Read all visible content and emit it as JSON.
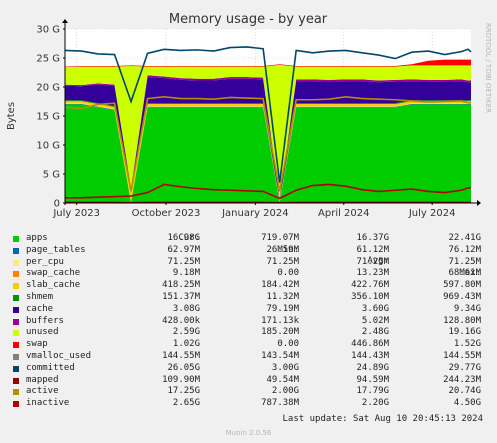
{
  "chart_data": {
    "type": "area",
    "title": "Memory usage - by year",
    "ylabel": "Bytes",
    "xlabel": "",
    "ylim": [
      0,
      30
    ],
    "yticks": [
      0,
      5,
      10,
      15,
      20,
      25,
      30
    ],
    "ytick_labels": [
      "0",
      "5 G",
      "10 G",
      "15 G",
      "20 G",
      "25 G",
      "30 G"
    ],
    "x_range": [
      "2023-06-19",
      "2024-08-10"
    ],
    "xticks": [
      {
        "date": "2023-07-01",
        "label": "July 2023"
      },
      {
        "date": "2023-10-01",
        "label": "October 2023"
      },
      {
        "date": "2024-01-01",
        "label": "January 2024"
      },
      {
        "date": "2024-04-01",
        "label": "April 2024"
      },
      {
        "date": "2024-07-01",
        "label": "July 2024"
      }
    ],
    "grid": true,
    "stacked_series": [
      {
        "name": "apps",
        "color": "#00cc00",
        "values": [
          17,
          17,
          16.5,
          16,
          0.1,
          16.5,
          16.5,
          16.5,
          16.5,
          16.5,
          16.5,
          16.5,
          16.5,
          0.1,
          16.5,
          16.5,
          16.5,
          16.5,
          16.5,
          16.5,
          16.5,
          17,
          17,
          17,
          17,
          17,
          17
        ]
      },
      {
        "name": "page_tables",
        "color": "#0066b3",
        "values": [
          0.1,
          0.1,
          0.1,
          0.1,
          0.05,
          0.1,
          0.1,
          0.1,
          0.1,
          0.1,
          0.1,
          0.1,
          0.1,
          0.05,
          0.1,
          0.1,
          0.1,
          0.1,
          0.1,
          0.1,
          0.1,
          0.1,
          0.1,
          0.1,
          0.1,
          0.1,
          0.1
        ]
      },
      {
        "name": "per_cpu",
        "color": "#ffe680",
        "values": [
          0.07,
          0.07,
          0.07,
          0.07,
          0.07,
          0.07,
          0.07,
          0.07,
          0.07,
          0.07,
          0.07,
          0.07,
          0.07,
          0.07,
          0.07,
          0.07,
          0.07,
          0.07,
          0.07,
          0.07,
          0.07,
          0.07,
          0.07,
          0.07,
          0.07,
          0.07,
          0.07
        ]
      },
      {
        "name": "swap_cache",
        "color": "#ff8000",
        "values": [
          0.0,
          0.0,
          0.0,
          0.0,
          0.0,
          0.0,
          0.0,
          0.0,
          0.0,
          0.0,
          0.0,
          0.0,
          0.0,
          0.0,
          0.0,
          0.0,
          0.0,
          0.0,
          0.0,
          0.0,
          0.0,
          0.0,
          0.0,
          0.0,
          0.0,
          0.0,
          0.0
        ]
      },
      {
        "name": "slab_cache",
        "color": "#ffcc00",
        "values": [
          0.4,
          0.4,
          0.4,
          0.4,
          2.0,
          0.4,
          0.4,
          0.4,
          0.4,
          0.4,
          0.4,
          0.4,
          0.4,
          0.2,
          0.4,
          0.4,
          0.4,
          0.4,
          0.4,
          0.4,
          0.4,
          0.4,
          0.4,
          0.4,
          0.4,
          0.4,
          0.4
        ]
      },
      {
        "name": "shmem",
        "color": "#008f00",
        "values": [
          0.15,
          0.15,
          0.15,
          0.15,
          0.1,
          0.15,
          0.15,
          0.15,
          0.15,
          0.15,
          0.15,
          0.15,
          0.15,
          0.1,
          0.15,
          0.15,
          0.15,
          0.15,
          0.15,
          0.15,
          0.15,
          0.15,
          0.15,
          0.15,
          0.15,
          0.15,
          0.15
        ]
      },
      {
        "name": "cache",
        "color": "#330099",
        "values": [
          2.5,
          2.4,
          3.2,
          3.5,
          0.2,
          4.5,
          4.3,
          4.0,
          3.9,
          3.9,
          4.2,
          4.2,
          4.1,
          0.2,
          3.8,
          3.8,
          3.7,
          3.8,
          3.8,
          3.6,
          3.7,
          3.3,
          3.2,
          3.2,
          3.3,
          3.1,
          3.1
        ]
      },
      {
        "name": "buffers",
        "color": "#990099",
        "values": [
          0.2,
          0.2,
          0.2,
          0.2,
          0.1,
          0.3,
          0.3,
          0.3,
          0.3,
          0.3,
          0.3,
          0.3,
          0.3,
          0.1,
          0.3,
          0.3,
          0.3,
          0.3,
          0.3,
          0.3,
          0.3,
          0.3,
          0.3,
          0.3,
          0.3,
          0.3,
          0.3
        ]
      },
      {
        "name": "unused",
        "color": "#ccff00",
        "values": [
          3.0,
          3.2,
          2.9,
          3.1,
          21.0,
          1.5,
          1.7,
          2.0,
          2.1,
          2.1,
          1.8,
          1.8,
          1.9,
          23.0,
          2.2,
          2.2,
          2.3,
          2.2,
          2.2,
          2.4,
          2.3,
          2.4,
          2.5,
          2.5,
          2.4,
          2.6,
          2.6
        ]
      },
      {
        "name": "swap",
        "color": "#ff0000",
        "values": [
          0.1,
          0.1,
          0.1,
          0.1,
          0.1,
          0.1,
          0.1,
          0.1,
          0.1,
          0.1,
          0.1,
          0.1,
          0.1,
          0.1,
          0.1,
          0.1,
          0.1,
          0.1,
          0.1,
          0.1,
          0.1,
          0.2,
          0.8,
          1.0,
          1.0,
          1.0,
          1.0
        ]
      }
    ],
    "line_series": [
      {
        "name": "vmalloc_used",
        "color": "#808080",
        "values": [
          0.14,
          0.14,
          0.14,
          0.14,
          0.14,
          0.14,
          0.14,
          0.14,
          0.14,
          0.14,
          0.14,
          0.14,
          0.14,
          0.14,
          0.14,
          0.14,
          0.14,
          0.14,
          0.14,
          0.14,
          0.14,
          0.14,
          0.14,
          0.14,
          0.14,
          0.14,
          0.14
        ]
      },
      {
        "name": "committed",
        "color": "#00476b",
        "values": [
          26.3,
          26.2,
          25.7,
          25.6,
          17.5,
          25.8,
          26.5,
          26.3,
          26.4,
          26.2,
          26.8,
          26.9,
          26.6,
          3.5,
          26.3,
          25.9,
          26.2,
          26.3,
          25.9,
          25.5,
          24.9,
          26.0,
          26.2,
          25.6,
          26.1,
          26.5,
          26.05
        ]
      },
      {
        "name": "mapped",
        "color": "#8f0000",
        "values": [
          0.1,
          0.1,
          0.1,
          0.1,
          0.05,
          0.1,
          0.1,
          0.1,
          0.1,
          0.1,
          0.1,
          0.1,
          0.1,
          0.05,
          0.1,
          0.1,
          0.1,
          0.1,
          0.1,
          0.1,
          0.1,
          0.1,
          0.1,
          0.1,
          0.1,
          0.1,
          0.11
        ]
      },
      {
        "name": "active",
        "color": "#b38f00",
        "values": [
          16.5,
          16.3,
          17.0,
          17.2,
          2.0,
          18.0,
          18.3,
          18.0,
          18.0,
          17.9,
          18.2,
          18.1,
          18.0,
          2.0,
          17.8,
          17.8,
          17.9,
          18.3,
          18.0,
          17.9,
          17.8,
          17.6,
          17.4,
          17.5,
          17.6,
          17.3,
          17.25
        ]
      },
      {
        "name": "inactive",
        "color": "#b30000",
        "values": [
          0.9,
          0.9,
          1.0,
          1.1,
          1.2,
          1.8,
          3.2,
          2.8,
          2.5,
          2.3,
          2.2,
          2.1,
          2.0,
          0.8,
          2.2,
          3.0,
          3.2,
          2.9,
          2.3,
          2.0,
          2.2,
          2.4,
          2.0,
          1.8,
          2.2,
          2.6,
          2.65
        ]
      }
    ],
    "dates": [
      "2023-06-19",
      "2023-07-06",
      "2023-07-23",
      "2023-08-09",
      "2023-08-26",
      "2023-09-12",
      "2023-09-29",
      "2023-10-16",
      "2023-11-02",
      "2023-11-19",
      "2023-12-06",
      "2023-12-23",
      "2024-01-09",
      "2024-01-26",
      "2024-02-12",
      "2024-02-29",
      "2024-03-17",
      "2024-04-03",
      "2024-04-20",
      "2024-05-07",
      "2024-05-24",
      "2024-06-10",
      "2024-06-27",
      "2024-07-14",
      "2024-07-31",
      "2024-08-07",
      "2024-08-10"
    ]
  },
  "side_label": "RRDTOOL / TOBI OETIKER",
  "legend": {
    "headers": {
      "cur": "Cur:",
      "min": "Min:",
      "avg": "Avg:",
      "max": "Max:"
    },
    "rows": [
      {
        "name": "apps",
        "color": "#00cc00",
        "cur": "16.98G",
        "min": "719.07M",
        "avg": "16.37G",
        "max": "22.41G"
      },
      {
        "name": "page_tables",
        "color": "#0066b3",
        "cur": "62.97M",
        "min": "26.59M",
        "avg": "61.12M",
        "max": "76.12M"
      },
      {
        "name": "per_cpu",
        "color": "#ffe680",
        "cur": "71.25M",
        "min": "71.25M",
        "avg": "71.25M",
        "max": "71.25M"
      },
      {
        "name": "swap_cache",
        "color": "#ff8000",
        "cur": "9.18M",
        "min": "0.00",
        "avg": "13.23M",
        "max": "68.61M"
      },
      {
        "name": "slab_cache",
        "color": "#ffcc00",
        "cur": "418.25M",
        "min": "184.42M",
        "avg": "422.76M",
        "max": "597.80M"
      },
      {
        "name": "shmem",
        "color": "#008f00",
        "cur": "151.37M",
        "min": "11.32M",
        "avg": "356.10M",
        "max": "969.43M"
      },
      {
        "name": "cache",
        "color": "#330099",
        "cur": "3.08G",
        "min": "79.19M",
        "avg": "3.60G",
        "max": "9.34G"
      },
      {
        "name": "buffers",
        "color": "#990099",
        "cur": "428.00k",
        "min": "171.13k",
        "avg": "5.02M",
        "max": "128.80M"
      },
      {
        "name": "unused",
        "color": "#ccff00",
        "cur": "2.59G",
        "min": "185.20M",
        "avg": "2.48G",
        "max": "19.16G"
      },
      {
        "name": "swap",
        "color": "#ff0000",
        "cur": "1.02G",
        "min": "0.00",
        "avg": "446.86M",
        "max": "1.52G"
      },
      {
        "name": "vmalloc_used",
        "color": "#808080",
        "cur": "144.55M",
        "min": "143.54M",
        "avg": "144.43M",
        "max": "144.55M"
      },
      {
        "name": "committed",
        "color": "#00476b",
        "cur": "26.05G",
        "min": "3.00G",
        "avg": "24.89G",
        "max": "29.77G"
      },
      {
        "name": "mapped",
        "color": "#8f0000",
        "cur": "109.90M",
        "min": "49.54M",
        "avg": "94.59M",
        "max": "244.23M"
      },
      {
        "name": "active",
        "color": "#b38f00",
        "cur": "17.25G",
        "min": "2.00G",
        "avg": "17.79G",
        "max": "20.74G"
      },
      {
        "name": "inactive",
        "color": "#b30000",
        "cur": "2.65G",
        "min": "787.38M",
        "avg": "2.20G",
        "max": "4.50G"
      }
    ]
  },
  "last_update": "Last update: Sat Aug 10 20:45:13 2024",
  "footer": "Munin 2.0.56"
}
